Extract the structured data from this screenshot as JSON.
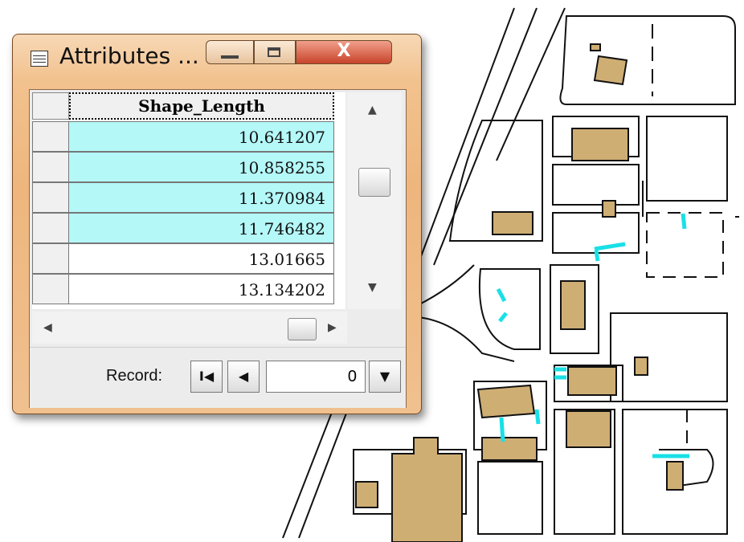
{
  "window": {
    "title": "Attributes ...",
    "close_glyph": "X",
    "icons": {
      "app": "table-icon",
      "minimize": "minimize-icon",
      "maximize": "maximize-icon",
      "close": "close-icon"
    }
  },
  "table": {
    "column_header": "Shape_Length",
    "rows": [
      {
        "value": "10.641207",
        "selected": true
      },
      {
        "value": "10.858255",
        "selected": true
      },
      {
        "value": "11.370984",
        "selected": true
      },
      {
        "value": "11.746482",
        "selected": true
      },
      {
        "value": "13.01665",
        "selected": false
      },
      {
        "value": "13.134202",
        "selected": false
      }
    ],
    "selection_color": "#b4f8f8"
  },
  "record_bar": {
    "label": "Record:",
    "value": "0",
    "icons": {
      "first": "first-record-icon",
      "prev": "previous-record-icon",
      "dropdown": "dropdown-arrow-icon"
    }
  },
  "map": {
    "building_color": "#cfae74",
    "highlight_color": "#19e0e6"
  }
}
